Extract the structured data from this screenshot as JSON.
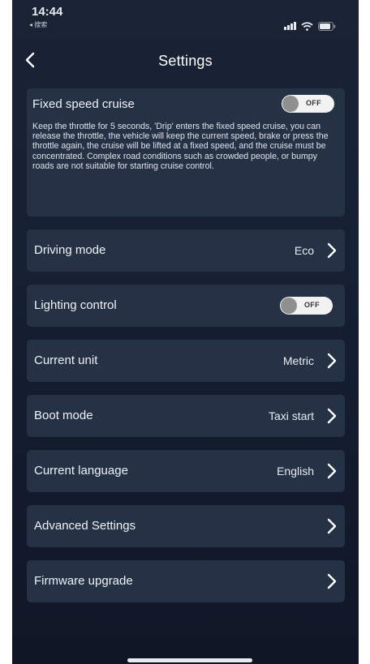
{
  "status_bar": {
    "time": "14:44",
    "back_app": "◂ 搜索"
  },
  "nav": {
    "title": "Settings"
  },
  "cruise": {
    "title": "Fixed speed cruise",
    "toggle_text": "OFF",
    "description": "Keep the throttle for 5 seconds, 'Drip' enters the fixed speed cruise, you can release the throttle, the vehicle will keep the current speed, brake or press the throttle again, the cruise will be lifted at a fixed speed, and the cruise must be concentrated. Complex road conditions such as crowded people, or bumpy roads are not suitable for starting cruise control."
  },
  "rows": [
    {
      "label": "Driving mode",
      "value": "Eco"
    },
    {
      "label": "Lighting control",
      "toggle_text": "OFF"
    },
    {
      "label": "Current unit",
      "value": "Metric"
    },
    {
      "label": "Boot mode",
      "value": "Taxi start"
    },
    {
      "label": "Current language",
      "value": "English"
    },
    {
      "label": "Advanced Settings",
      "value": ""
    },
    {
      "label": "Firmware upgrade",
      "value": ""
    }
  ],
  "colors": {
    "background": "#162033",
    "card": "#253246",
    "text": "#f0f2f6",
    "toggle_track": "#f2f2f2",
    "toggle_knob": "#8f8f8f"
  }
}
